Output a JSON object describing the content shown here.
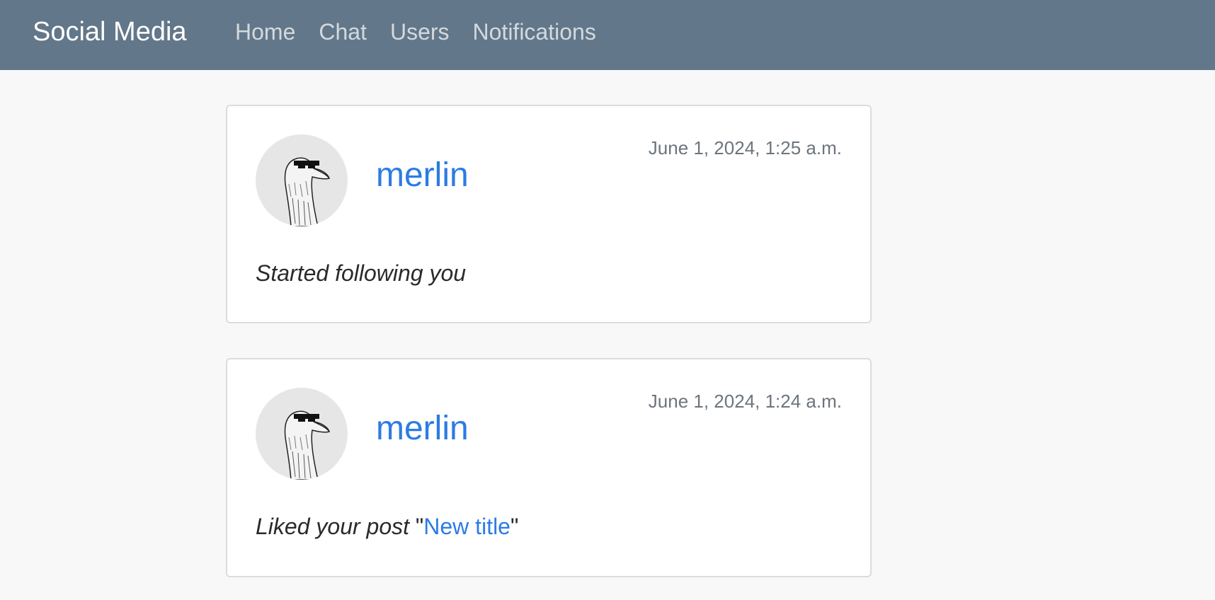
{
  "navbar": {
    "brand": "Social Media",
    "links": [
      "Home",
      "Chat",
      "Users",
      "Notifications"
    ]
  },
  "notifications": [
    {
      "username": "merlin",
      "timestamp": "June 1, 2024, 1:25 a.m.",
      "message": "Started following you"
    },
    {
      "username": "merlin",
      "timestamp": "June 1, 2024, 1:24 a.m.",
      "message_prefix": "Liked your post ",
      "quote_open": "\"",
      "post_title": "New title",
      "quote_close": "\""
    }
  ],
  "colors": {
    "navbar_bg": "#627789",
    "link_blue": "#2c7be5",
    "page_bg": "#f8f8f8"
  }
}
